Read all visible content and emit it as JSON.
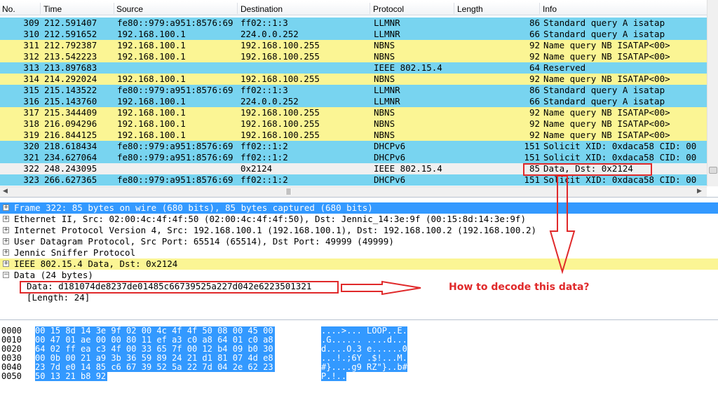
{
  "packet_list": {
    "columns": [
      "No.",
      "Time",
      "Source",
      "Destination",
      "Protocol",
      "Length",
      "Info"
    ],
    "colors": {
      "blue": "#78d4f0",
      "yellow": "#fbf594",
      "selected": "#f0f0f0"
    },
    "rows": [
      {
        "no": "309",
        "time": "212.591407",
        "src": "fe80::979:a951:8576:69",
        "dst": "ff02::1:3",
        "proto": "LLMNR",
        "len": "86",
        "info": "Standard query A isatap",
        "color": "blue"
      },
      {
        "no": "310",
        "time": "212.591652",
        "src": "192.168.100.1",
        "dst": "224.0.0.252",
        "proto": "LLMNR",
        "len": "66",
        "info": "Standard query A isatap",
        "color": "blue"
      },
      {
        "no": "311",
        "time": "212.792387",
        "src": "192.168.100.1",
        "dst": "192.168.100.255",
        "proto": "NBNS",
        "len": "92",
        "info": "Name query NB ISATAP<00>",
        "color": "yellow"
      },
      {
        "no": "312",
        "time": "213.542223",
        "src": "192.168.100.1",
        "dst": "192.168.100.255",
        "proto": "NBNS",
        "len": "92",
        "info": "Name query NB ISATAP<00>",
        "color": "yellow"
      },
      {
        "no": "313",
        "time": "213.897683",
        "src": "",
        "dst": "",
        "proto": "IEEE 802.15.4",
        "len": "64",
        "info": "Reserved",
        "color": "blue"
      },
      {
        "no": "314",
        "time": "214.292024",
        "src": "192.168.100.1",
        "dst": "192.168.100.255",
        "proto": "NBNS",
        "len": "92",
        "info": "Name query NB ISATAP<00>",
        "color": "yellow"
      },
      {
        "no": "315",
        "time": "215.143522",
        "src": "fe80::979:a951:8576:69",
        "dst": "ff02::1:3",
        "proto": "LLMNR",
        "len": "86",
        "info": "Standard query A isatap",
        "color": "blue"
      },
      {
        "no": "316",
        "time": "215.143760",
        "src": "192.168.100.1",
        "dst": "224.0.0.252",
        "proto": "LLMNR",
        "len": "66",
        "info": "Standard query A isatap",
        "color": "blue"
      },
      {
        "no": "317",
        "time": "215.344409",
        "src": "192.168.100.1",
        "dst": "192.168.100.255",
        "proto": "NBNS",
        "len": "92",
        "info": "Name query NB ISATAP<00>",
        "color": "yellow"
      },
      {
        "no": "318",
        "time": "216.094296",
        "src": "192.168.100.1",
        "dst": "192.168.100.255",
        "proto": "NBNS",
        "len": "92",
        "info": "Name query NB ISATAP<00>",
        "color": "yellow"
      },
      {
        "no": "319",
        "time": "216.844125",
        "src": "192.168.100.1",
        "dst": "192.168.100.255",
        "proto": "NBNS",
        "len": "92",
        "info": "Name query NB ISATAP<00>",
        "color": "yellow"
      },
      {
        "no": "320",
        "time": "218.618434",
        "src": "fe80::979:a951:8576:69",
        "dst": "ff02::1:2",
        "proto": "DHCPv6",
        "len": "151",
        "info": "Solicit XID: 0xdaca58 CID: 00",
        "color": "blue"
      },
      {
        "no": "321",
        "time": "234.627064",
        "src": "fe80::979:a951:8576:69",
        "dst": "ff02::1:2",
        "proto": "DHCPv6",
        "len": "151",
        "info": "Solicit XID: 0xdaca58 CID: 00",
        "color": "blue"
      },
      {
        "no": "322",
        "time": "248.243095",
        "src": "",
        "dst": "0x2124",
        "proto": "IEEE 802.15.4",
        "len": "85",
        "info": "Data, Dst: 0x2124",
        "color": "selected"
      },
      {
        "no": "323",
        "time": "266.627365",
        "src": "fe80::979:a951:8576:69",
        "dst": "ff02::1:2",
        "proto": "DHCPv6",
        "len": "151",
        "info": "Solicit XID: 0xdaca58 CID: 00",
        "color": "blue"
      }
    ]
  },
  "details": {
    "tree": [
      {
        "text": "Frame 322: 85 bytes on wire (680 bits), 85 bytes captured (680 bits)",
        "expander": "+",
        "style": "selected"
      },
      {
        "text": "Ethernet II, Src: 02:00:4c:4f:4f:50 (02:00:4c:4f:4f:50), Dst: Jennic_14:3e:9f (00:15:8d:14:3e:9f)",
        "expander": "+",
        "style": "plain"
      },
      {
        "text": "Internet Protocol Version 4, Src: 192.168.100.1 (192.168.100.1), Dst: 192.168.100.2 (192.168.100.2)",
        "expander": "+",
        "style": "plain"
      },
      {
        "text": "User Datagram Protocol, Src Port: 65514 (65514), Dst Port: 49999 (49999)",
        "expander": "+",
        "style": "plain"
      },
      {
        "text": "Jennic Sniffer Protocol",
        "expander": "+",
        "style": "plain"
      },
      {
        "text": "IEEE 802.15.4 Data, Dst: 0x2124",
        "expander": "+",
        "style": "yellow"
      },
      {
        "text": "Data (24 bytes)",
        "expander": "−",
        "style": "plain"
      }
    ],
    "data_line": "Data: d181074de8237de01485c66739525a227d042e6223501321",
    "length_line": "[Length: 24]",
    "colors": {
      "selected": "#3399ff",
      "yellow": "#fbf594"
    }
  },
  "bytes": [
    {
      "offset": "0000",
      "hex": "00 15 8d 14 3e 9f 02 00  4c 4f 4f 50 08 00 45 00",
      "ascii": "....>... LOOP..E."
    },
    {
      "offset": "0010",
      "hex": "00 47 01 ae 00 00 80 11  ef a3 c0 a8 64 01 c0 a8",
      "ascii": ".G...... ....d..."
    },
    {
      "offset": "0020",
      "hex": "64 02 ff ea c3 4f 00 33  65 7f 00 12 b4 09 b0 30",
      "ascii": "d....O.3 e......0"
    },
    {
      "offset": "0030",
      "hex": "00 0b 00 21 a9 3b 36 59  89 24 21 d1 81 07 4d e8",
      "ascii": "...!.;6Y .$!...M."
    },
    {
      "offset": "0040",
      "hex": "23 7d e0 14 85 c6 67 39  52 5a 22 7d 04 2e 62 23",
      "ascii": "#}....g9 RZ\"}..b#"
    },
    {
      "offset": "0050",
      "hex": "50 13 21 b8 92",
      "ascii": "P.!.."
    }
  ],
  "annotation": {
    "question": "How to decode this data?",
    "color": "#e0292a"
  }
}
